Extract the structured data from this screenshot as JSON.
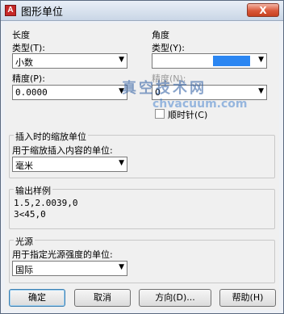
{
  "window": {
    "title": "图形单位",
    "app_icon_letter": "A",
    "close_label": "X"
  },
  "length": {
    "group_label": "长度",
    "type_label": "类型(T):",
    "type_value": "小数",
    "precision_label": "精度(P):",
    "precision_value": "0.0000"
  },
  "angle": {
    "group_label": "角度",
    "type_label": "类型(Y):",
    "precision_label": "精度(N):",
    "precision_value": "0",
    "clockwise_label": "顺时针(C)",
    "clockwise_checked": false,
    "highlight_color": "#2b86f2"
  },
  "insertion": {
    "group_label": "插入时的缩放单位",
    "prompt": "用于缩放插入内容的单位:",
    "value": "毫米"
  },
  "sample": {
    "group_label": "输出样例",
    "line1": "1.5,2.0039,0",
    "line2": "3<45,0"
  },
  "lighting": {
    "group_label": "光源",
    "prompt": "用于指定光源强度的单位:",
    "value": "国际"
  },
  "buttons": {
    "ok": "确定",
    "cancel": "取消",
    "direction": "方向(D)...",
    "help": "帮助(H)"
  },
  "watermark": {
    "line1": "真空技术网",
    "line2": "chvacuum.com"
  }
}
